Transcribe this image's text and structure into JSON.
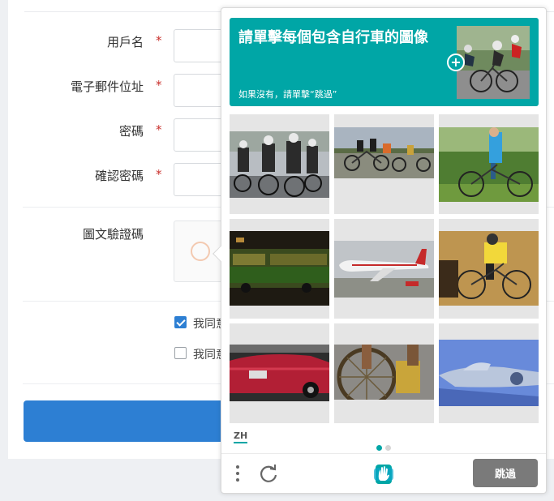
{
  "form": {
    "username_label": "用戶名",
    "email_label": "電子郵件位址",
    "password_label": "密碼",
    "confirm_password_label": "確認密碼",
    "required_mark": "*",
    "captcha_label": "圖文驗證碼",
    "agree_1": {
      "label": "我同意",
      "checked": true
    },
    "agree_2": {
      "label": "我同意",
      "checked": false
    }
  },
  "challenge": {
    "prompt": "請單擊每個包含自行車的圖像",
    "hint": "如果沒有，請單擊“跳過”",
    "example_image": "cyclists-racing",
    "tiles": [
      {
        "subject": "cyclists-race-group"
      },
      {
        "subject": "tandem-bicycle-riders"
      },
      {
        "subject": "boy-with-bicycle"
      },
      {
        "subject": "night-bus"
      },
      {
        "subject": "airplane-on-runway"
      },
      {
        "subject": "cyclist-on-trainer"
      },
      {
        "subject": "red-car"
      },
      {
        "subject": "wheel-repair"
      },
      {
        "subject": "fighter-jet"
      }
    ],
    "language": "ZH",
    "page_dots": [
      true,
      false
    ],
    "skip_label": "跳過",
    "icons": {
      "menu": "more-vertical-icon",
      "refresh": "refresh-icon",
      "logo": "hcaptcha-logo-icon"
    },
    "accent_color": "#00a6a6"
  },
  "colors": {
    "primary_button": "#2d7fd3",
    "required": "#c9302c"
  }
}
